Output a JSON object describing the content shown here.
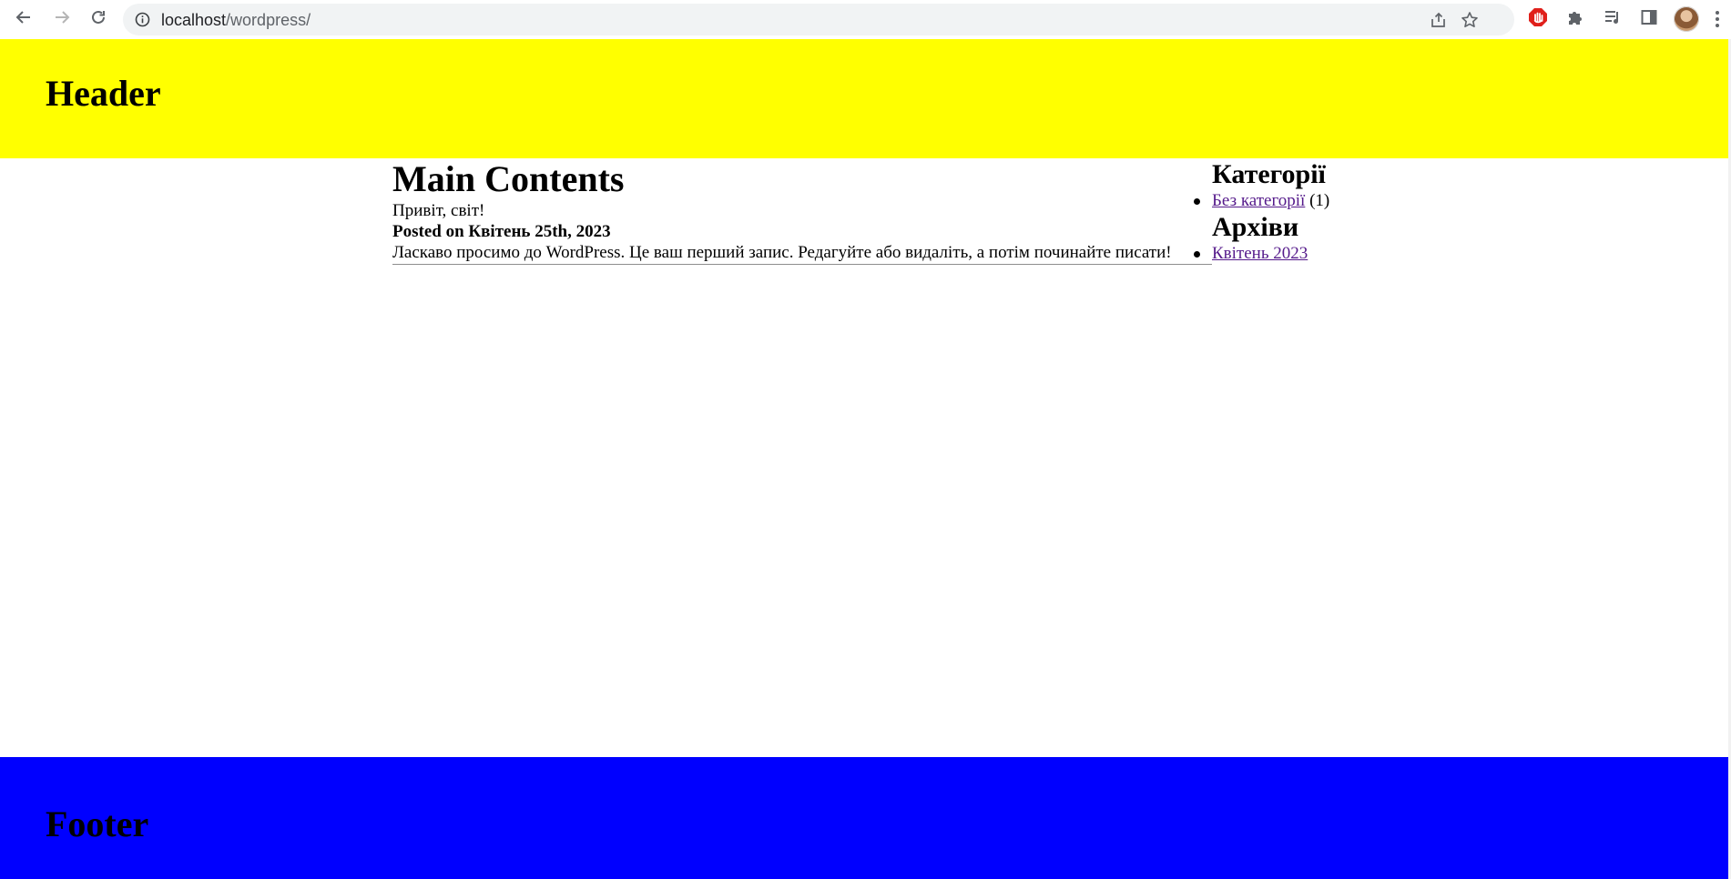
{
  "browser": {
    "url_host": "localhost",
    "url_path": "/wordpress/",
    "icons": {
      "back": "arrow-left-icon",
      "forward": "arrow-right-icon",
      "reload": "reload-icon",
      "site_info": "info-icon",
      "share": "share-icon",
      "bookmark": "star-icon",
      "adblock": "stop-hand-icon",
      "extensions": "puzzle-icon",
      "media": "playlist-icon",
      "side_panel": "side-panel-icon",
      "menu": "kebab-menu-icon"
    },
    "colors": {
      "adblock": "#e0201b"
    }
  },
  "header": {
    "title": "Header",
    "background": "#ffff00"
  },
  "main": {
    "heading": "Main Contents",
    "post": {
      "title": "Привіт, світ!",
      "date_line": "Posted on Квітень 25th, 2023",
      "excerpt": "Ласкаво просимо до WordPress. Це ваш перший запис. Редагуйте або видаліть, а потім починайте писати!"
    }
  },
  "sidebar": {
    "categories": {
      "heading": "Категорії",
      "items": [
        {
          "label": "Без категорії",
          "count": " (1)"
        }
      ]
    },
    "archives": {
      "heading": "Архіви",
      "items": [
        {
          "label": "Квітень 2023"
        }
      ]
    },
    "link_color": "#551a8b"
  },
  "footer": {
    "title": "Footer",
    "background": "#0000ff"
  }
}
